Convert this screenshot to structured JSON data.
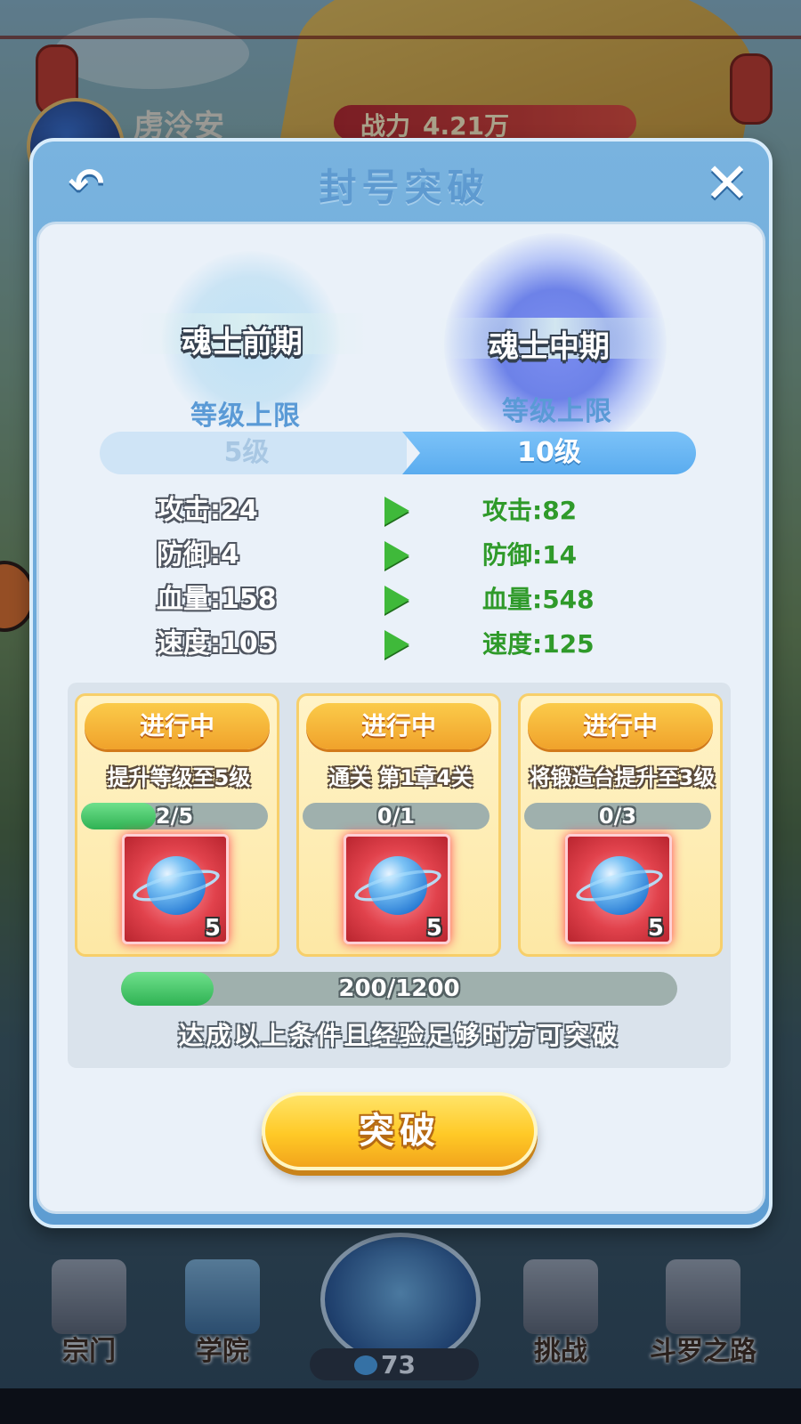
{
  "scene": {
    "player_name": "虏泠安",
    "power_label": "战力",
    "power_value": "4.21万",
    "bottom_nav": [
      {
        "label": "宗门",
        "icon": "sect-tower-icon"
      },
      {
        "label": "学院",
        "icon": "academy-pagoda-icon"
      },
      {
        "label": "挑战",
        "icon": "challenge-armor-icon"
      },
      {
        "label": "斗罗之路",
        "icon": "road-stones-icon"
      }
    ],
    "center_count": "73"
  },
  "dialog": {
    "title": "封号突破",
    "back_icon": "back-arrow-icon",
    "close_icon": "close-icon",
    "current_rank": "魂士前期",
    "next_rank": "魂士中期",
    "limit_label": "等级上限",
    "current_limit": "5级",
    "next_limit": "10级",
    "stats": [
      {
        "old": "攻击:24",
        "new": "攻击:82"
      },
      {
        "old": "防御:4",
        "new": "防御:14"
      },
      {
        "old": "血量:158",
        "new": "血量:548"
      },
      {
        "old": "速度:105",
        "new": "速度:125"
      }
    ],
    "tasks": [
      {
        "status": "进行中",
        "desc": "提升等级至5级",
        "progress_text": "2/5",
        "progress": 0.4,
        "reward_count": "5"
      },
      {
        "status": "进行中",
        "desc": "通关 第1章4关",
        "progress_text": "0/1",
        "progress": 0,
        "reward_count": "5"
      },
      {
        "status": "进行中",
        "desc": "将锻造台提升至3级",
        "progress_text": "0/3",
        "progress": 0,
        "reward_count": "5"
      }
    ],
    "exp_text": "200/1200",
    "exp_progress": 0.1667,
    "hint": "达成以上条件且经验足够时方可突破",
    "breakthrough_label": "突破"
  },
  "colors": {
    "dialog_frame": "#6aa7d8",
    "new_stat_green": "#2f9a2a",
    "button_gold": "#ffc926",
    "progress_green": "#2fb253"
  }
}
